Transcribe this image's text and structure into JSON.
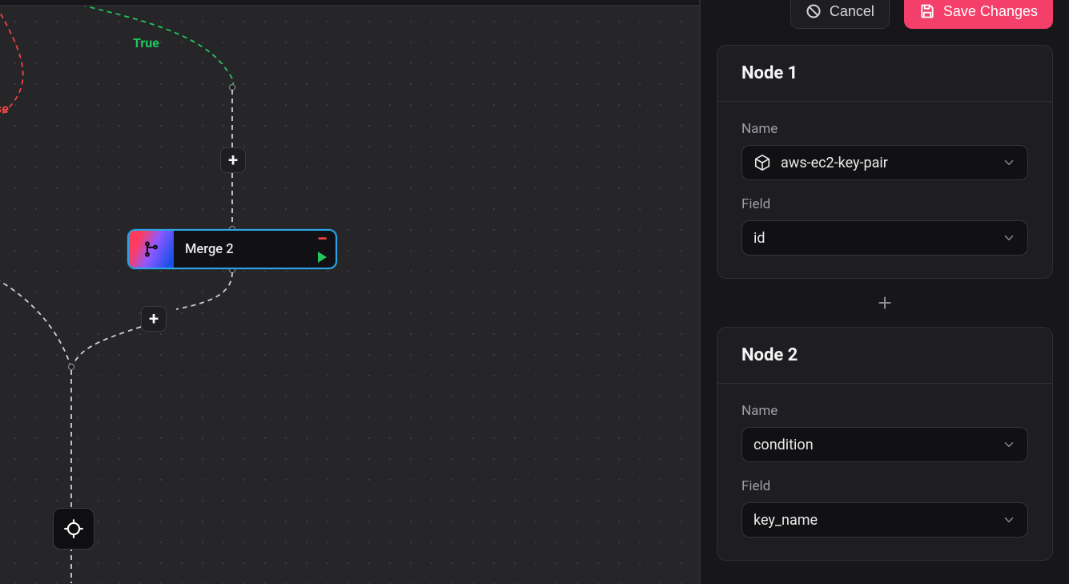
{
  "actions": {
    "cancel_label": "Cancel",
    "save_label": "Save Changes"
  },
  "canvas": {
    "edge_labels": {
      "true": "True",
      "false": "se"
    },
    "nodes": [
      {
        "id": "merge2",
        "label": "Merge 2"
      }
    ],
    "icons": {
      "add": "+",
      "minus": "−"
    }
  },
  "panel": {
    "sections": [
      {
        "title": "Node 1",
        "fields": {
          "name_label": "Name",
          "name_value": "aws-ec2-key-pair",
          "name_icon": "cube-icon",
          "field_label": "Field",
          "field_value": "id"
        }
      },
      {
        "title": "Node 2",
        "fields": {
          "name_label": "Name",
          "name_value": "condition",
          "name_icon": "",
          "field_label": "Field",
          "field_value": "key_name"
        }
      }
    ]
  }
}
